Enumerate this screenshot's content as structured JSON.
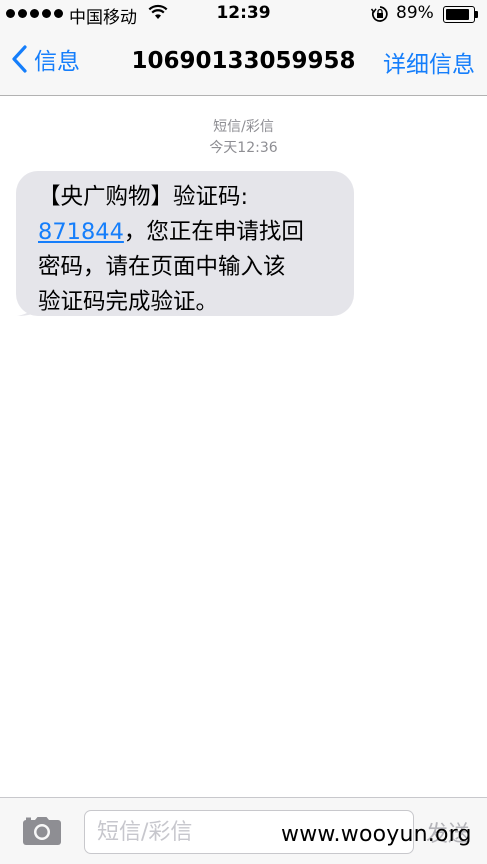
{
  "status_bar": {
    "carrier": "中国移动",
    "time": "12:39",
    "battery_percent": "89%",
    "battery_level": 0.89,
    "signal_bars": 5
  },
  "nav": {
    "back_label": "信息",
    "title": "10690133059958",
    "details_label": "详细信息"
  },
  "thread": {
    "message_type": "短信/彩信",
    "timestamp": "今天12:36",
    "message": {
      "line1": "【央广购物】验证码:",
      "code": "871844",
      "line2_rest": "，您正在申请找回",
      "line3": "密码，请在页面中输入该",
      "line4": "验证码完成验证。"
    }
  },
  "toolbar": {
    "input_placeholder": "短信/彩信",
    "send_label": "发送"
  },
  "watermark": "www.wooyun.org",
  "colors": {
    "accent": "#157efb",
    "bubble": "#e5e5ea",
    "meta_text": "#8e8e93"
  }
}
